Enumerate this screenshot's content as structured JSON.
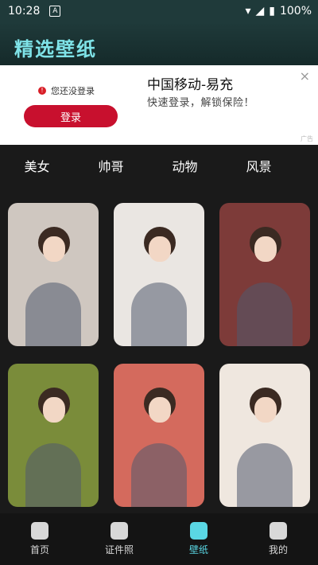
{
  "status_bar": {
    "time": "10:28",
    "indicator": "A",
    "battery": "100%"
  },
  "app": {
    "title": "精选壁纸"
  },
  "ad": {
    "warning": "您还没登录",
    "login_button": "登录",
    "title": "中国移动-易充",
    "subtitle": "快速登录，解锁保险！",
    "close": "×",
    "tag": "广告"
  },
  "categories": [
    {
      "label": "美女"
    },
    {
      "label": "帅哥"
    },
    {
      "label": "动物"
    },
    {
      "label": "风景"
    }
  ],
  "wallpapers": [
    {
      "id": "w1",
      "color": "#cfc7c0"
    },
    {
      "id": "w2",
      "color": "#eae6e2"
    },
    {
      "id": "w3",
      "color": "#7d3b39"
    },
    {
      "id": "w4",
      "color": "#7a8c3a"
    },
    {
      "id": "w5",
      "color": "#d46a5d"
    },
    {
      "id": "w6",
      "color": "#efe7df"
    }
  ],
  "bottom_nav": [
    {
      "label": "首页",
      "icon": "home-icon",
      "active": false
    },
    {
      "label": "证件照",
      "icon": "id-card-icon",
      "active": false
    },
    {
      "label": "壁纸",
      "icon": "wallpaper-icon",
      "active": true
    },
    {
      "label": "我的",
      "icon": "user-icon",
      "active": false
    }
  ]
}
